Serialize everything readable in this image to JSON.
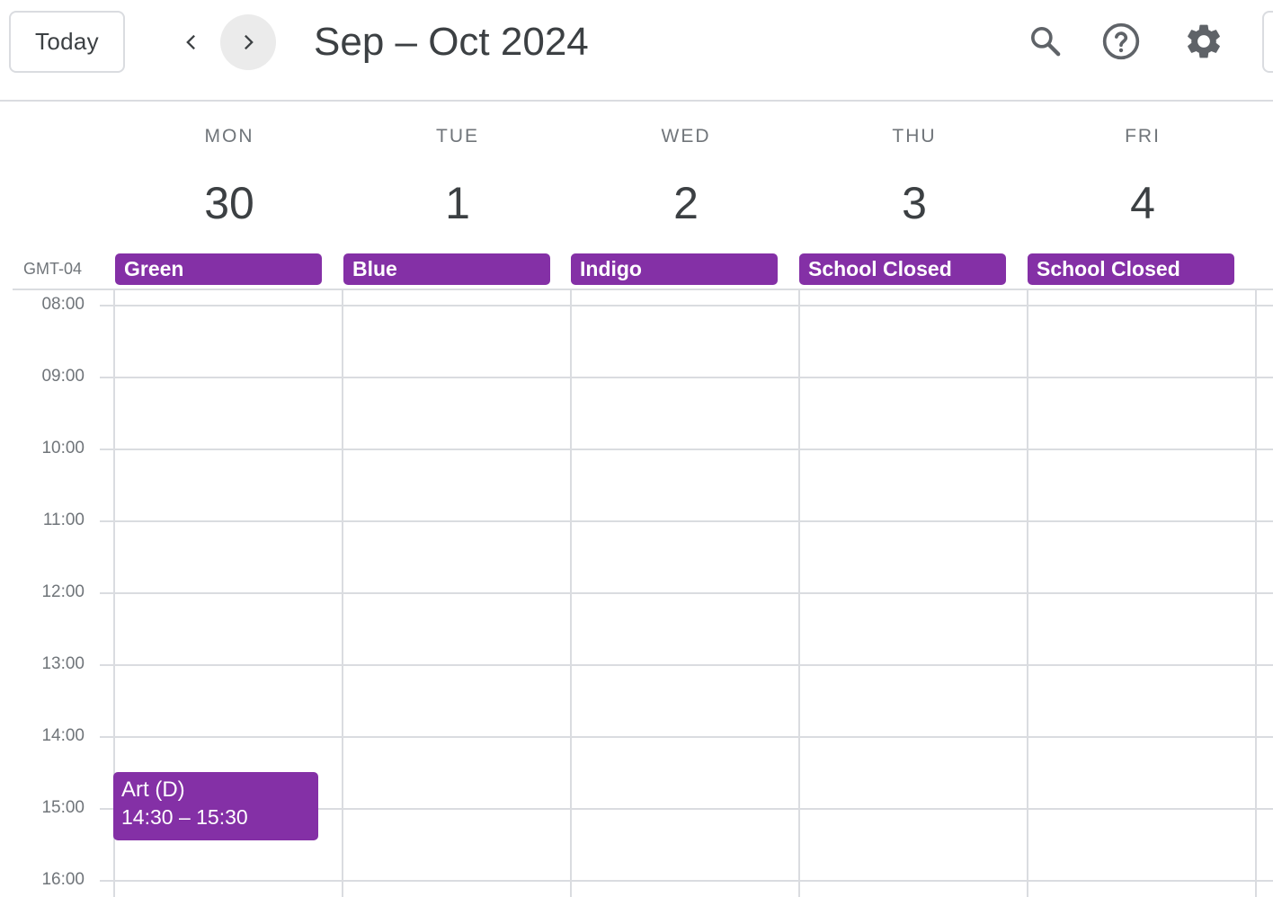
{
  "header": {
    "today_label": "Today",
    "date_range": "Sep – Oct 2024",
    "icons": [
      "chevron-left-icon",
      "chevron-right-icon",
      "search-icon",
      "help-icon",
      "settings-icon"
    ]
  },
  "timezone": "GMT-04",
  "days": [
    {
      "dow": "MON",
      "num": "30"
    },
    {
      "dow": "TUE",
      "num": "1"
    },
    {
      "dow": "WED",
      "num": "2"
    },
    {
      "dow": "THU",
      "num": "3"
    },
    {
      "dow": "FRI",
      "num": "4"
    }
  ],
  "all_day_events": [
    {
      "day": "MON",
      "title": "Green"
    },
    {
      "day": "TUE",
      "title": "Blue"
    },
    {
      "day": "WED",
      "title": "Indigo"
    },
    {
      "day": "THU",
      "title": "School Closed"
    },
    {
      "day": "FRI",
      "title": "School Closed"
    }
  ],
  "time_labels": [
    "08:00",
    "09:00",
    "10:00",
    "11:00",
    "12:00",
    "13:00",
    "14:00",
    "15:00",
    "16:00"
  ],
  "events": [
    {
      "day": "MON",
      "title": "Art (D)",
      "time": "14:30 – 15:30"
    }
  ],
  "colors": {
    "event": "#8430a6",
    "grid": "#dadce0",
    "muted_text": "#70757a",
    "text": "#3c4043"
  }
}
